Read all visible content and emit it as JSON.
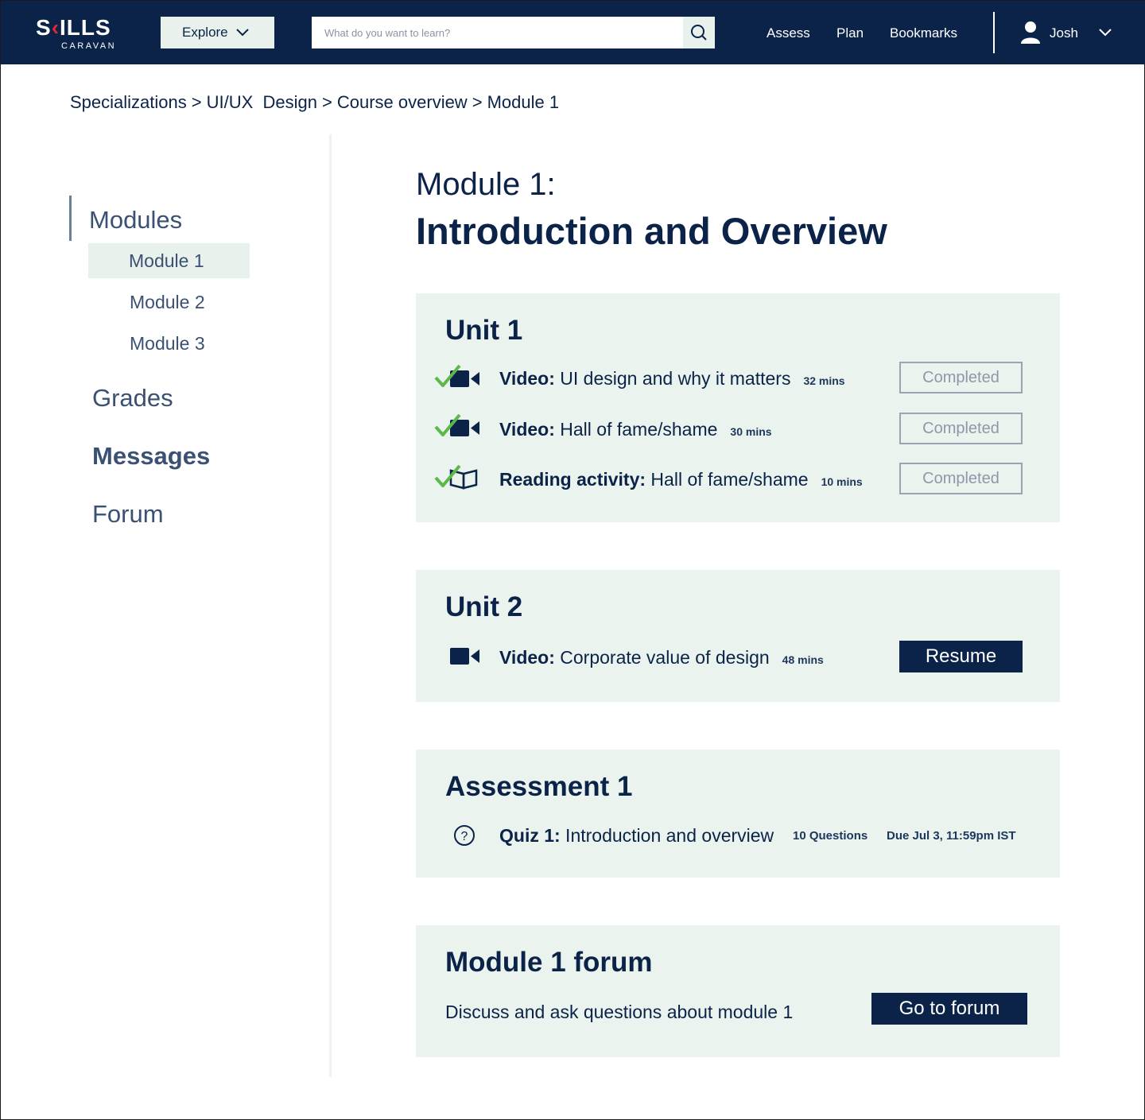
{
  "brand": {
    "logo_left": "S",
    "logo_accent": "K",
    "logo_right": "ILLS",
    "logo_sub": "CARAVAN"
  },
  "header": {
    "explore_label": "Explore",
    "search_placeholder": "What do you want to learn?",
    "nav": [
      "Assess",
      "Plan",
      "Bookmarks"
    ],
    "user_name": "Josh"
  },
  "breadcrumb": [
    "Specializations",
    "UI/UX  Design",
    "Course overview",
    "Module 1"
  ],
  "breadcrumb_separator": ">",
  "sidebar": {
    "modules_title": "Modules",
    "modules": [
      "Module 1",
      "Module 2",
      "Module 3"
    ],
    "active_module_index": 0,
    "grades": "Grades",
    "messages": "Messages",
    "forum": "Forum"
  },
  "page": {
    "kicker": "Module 1:",
    "title": "Introduction and Overview"
  },
  "unit1": {
    "title": "Unit 1",
    "items": [
      {
        "type_label": "Video:",
        "title": " UI design and why it matters",
        "duration": "32 mins",
        "status": "Completed",
        "icon": "video-icon",
        "done": true
      },
      {
        "type_label": "Video:",
        "title": " Hall of fame/shame",
        "duration": "30 mins",
        "status": "Completed",
        "icon": "video-icon",
        "done": true
      },
      {
        "type_label": "Reading activity:",
        "title": " Hall of fame/shame",
        "duration": "10 mins",
        "status": "Completed",
        "icon": "book-icon",
        "done": true
      }
    ]
  },
  "unit2": {
    "title": "Unit 2",
    "item": {
      "type_label": "Video:",
      "title": " Corporate value of design",
      "duration": "48 mins",
      "action": "Resume",
      "icon": "video-icon"
    }
  },
  "assessment": {
    "title": "Assessment 1",
    "quiz_label": "Quiz 1:",
    "quiz_title": " Introduction and overview",
    "questions": "10 Questions",
    "due": "Due Jul 3, 11:59pm IST"
  },
  "forum_card": {
    "title": "Module 1 forum",
    "description": "Discuss and ask questions about module 1",
    "action": "Go to forum"
  },
  "colors": {
    "navy": "#0b2349",
    "mint": "#ebf3ee",
    "check_green": "#5cb84a",
    "logo_red": "#e3262f"
  }
}
